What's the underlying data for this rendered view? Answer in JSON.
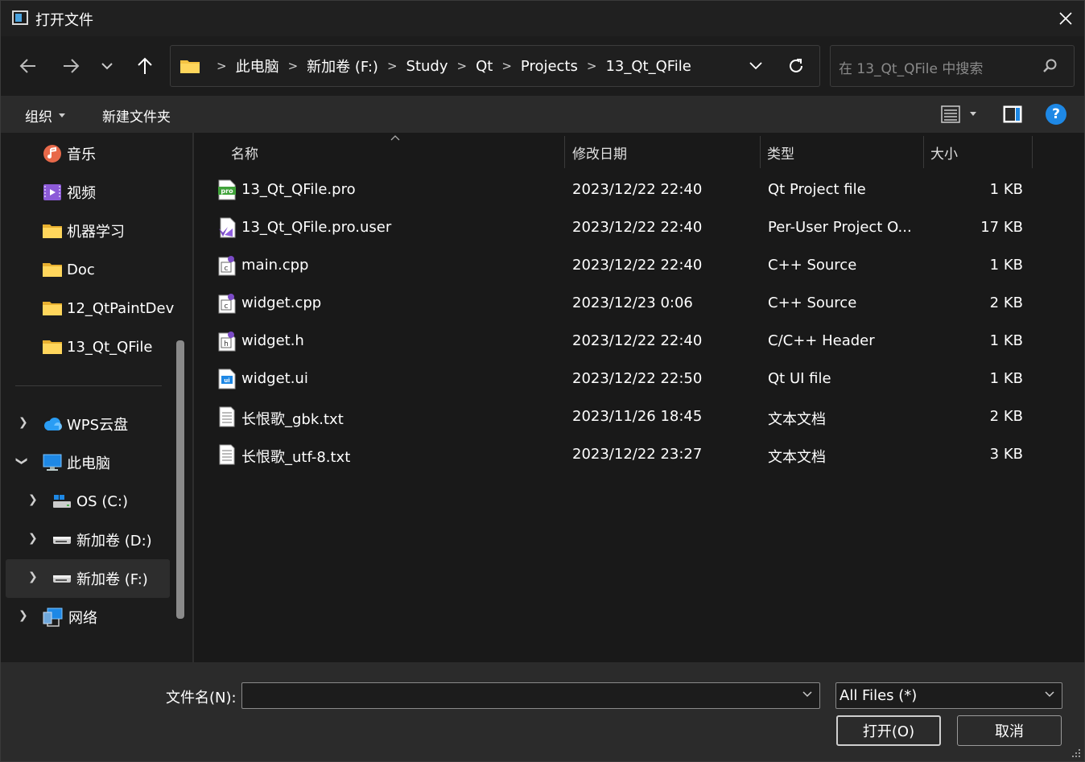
{
  "title": "打开文件",
  "address": {
    "crumbs": [
      "此电脑",
      "新加卷 (F:)",
      "Study",
      "Qt",
      "Projects",
      "13_Qt_QFile"
    ]
  },
  "search": {
    "placeholder": "在 13_Qt_QFile 中搜索"
  },
  "toolbar": {
    "organize": "组织",
    "new_folder": "新建文件夹"
  },
  "sidebar": {
    "quick": [
      {
        "label": "音乐",
        "icon": "music-icon",
        "pinned": true
      },
      {
        "label": "视频",
        "icon": "video-icon",
        "pinned": true
      },
      {
        "label": "机器学习",
        "icon": "folder-icon",
        "pinned": false
      },
      {
        "label": "Doc",
        "icon": "folder-icon",
        "pinned": false
      },
      {
        "label": "12_QtPaintDev",
        "icon": "folder-icon",
        "pinned": false
      },
      {
        "label": "13_Qt_QFile",
        "icon": "folder-icon",
        "pinned": false
      }
    ],
    "tree": [
      {
        "label": "WPS云盘",
        "icon": "cloud-icon"
      },
      {
        "label": "此电脑",
        "icon": "computer-icon"
      },
      {
        "label": "OS (C:)",
        "icon": "drive-c-icon"
      },
      {
        "label": "新加卷 (D:)",
        "icon": "drive-icon"
      },
      {
        "label": "新加卷 (F:)",
        "icon": "drive-icon"
      },
      {
        "label": "网络",
        "icon": "network-icon"
      }
    ]
  },
  "columns": {
    "name": "名称",
    "modified": "修改日期",
    "type": "类型",
    "size": "大小"
  },
  "files": [
    {
      "name": "13_Qt_QFile.pro",
      "modified": "2023/12/22 22:40",
      "type": "Qt Project file",
      "size": "1 KB",
      "icon": "pro-file-icon"
    },
    {
      "name": "13_Qt_QFile.pro.user",
      "modified": "2023/12/22 22:40",
      "type": "Per-User Project O...",
      "size": "17 KB",
      "icon": "user-file-icon"
    },
    {
      "name": "main.cpp",
      "modified": "2023/12/22 22:40",
      "type": "C++ Source",
      "size": "1 KB",
      "icon": "cpp-file-icon"
    },
    {
      "name": "widget.cpp",
      "modified": "2023/12/23 0:06",
      "type": "C++ Source",
      "size": "2 KB",
      "icon": "cpp-file-icon"
    },
    {
      "name": "widget.h",
      "modified": "2023/12/22 22:40",
      "type": "C/C++ Header",
      "size": "1 KB",
      "icon": "header-file-icon"
    },
    {
      "name": "widget.ui",
      "modified": "2023/12/22 22:50",
      "type": "Qt UI file",
      "size": "1 KB",
      "icon": "ui-file-icon"
    },
    {
      "name": "长恨歌_gbk.txt",
      "modified": "2023/11/26 18:45",
      "type": "文本文档",
      "size": "2 KB",
      "icon": "text-file-icon"
    },
    {
      "name": "长恨歌_utf-8.txt",
      "modified": "2023/12/22 23:27",
      "type": "文本文档",
      "size": "3 KB",
      "icon": "text-file-icon"
    }
  ],
  "bottom": {
    "filename_label": "文件名(N):",
    "filename_value": "",
    "filter": "All Files  (*)",
    "open": "打开(O)",
    "cancel": "取消"
  },
  "colors": {
    "accent": "#1e88e5",
    "folder": "#f5c342",
    "background": "#1c1c1c"
  }
}
